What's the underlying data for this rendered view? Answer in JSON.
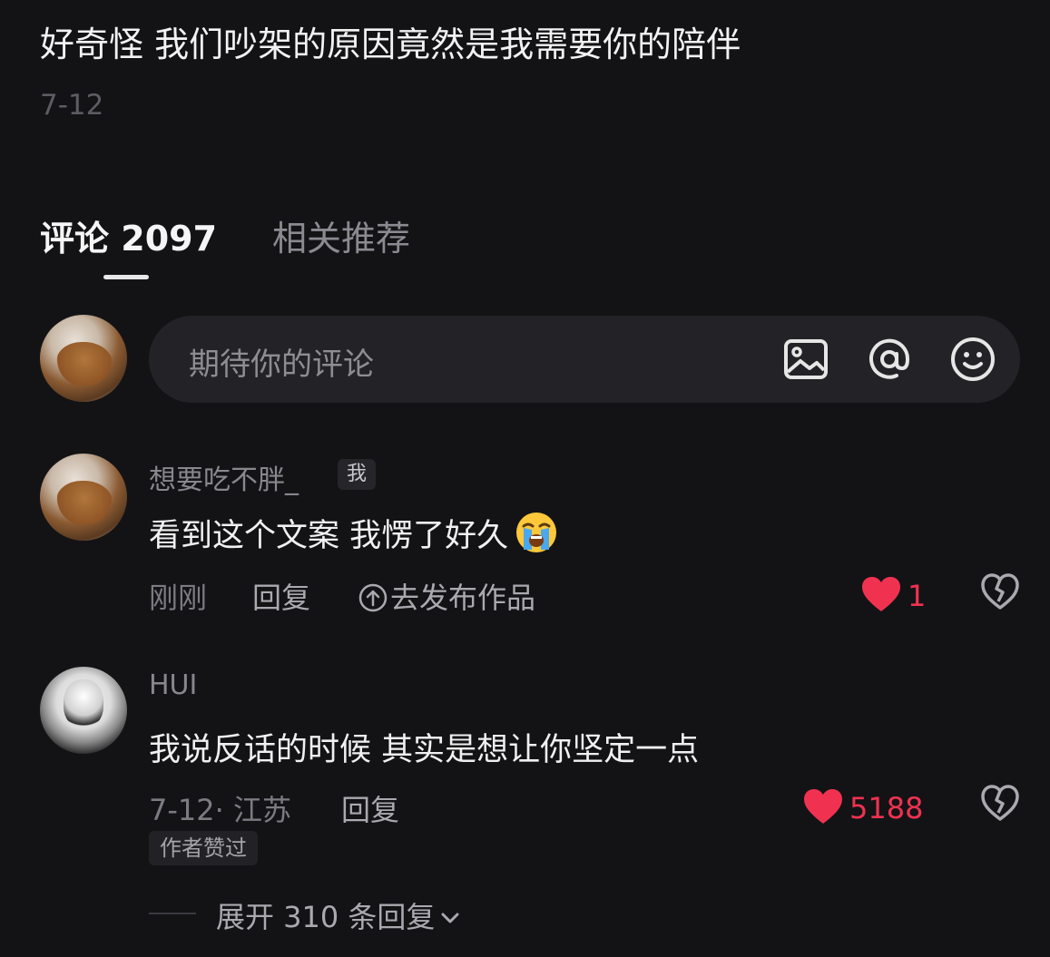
{
  "video": {
    "title": "好奇怪 我们吵架的原因竟然是我需要你的陪伴",
    "date": "7-12"
  },
  "tabs": {
    "comments_label": "评论",
    "comments_count": "2097",
    "related_label": "相关推荐"
  },
  "comment_input": {
    "placeholder": "期待你的评论"
  },
  "comments": [
    {
      "username": "想要吃不胖_",
      "self_badge": "我",
      "text": "看到这个文案 我愣了好久",
      "emoji": "loudly-crying-face",
      "time": "刚刚",
      "reply_label": "回复",
      "publish_label": "去发布作品",
      "likes": "1",
      "liked": true
    },
    {
      "username": "HUI",
      "text": "我说反话的时候 其实是想让你坚定一点",
      "time_location": "7-12· 江苏",
      "reply_label": "回复",
      "likes": "5188",
      "liked": true,
      "author_liked_label": "作者赞过",
      "expand_label": "展开 310 条回复"
    }
  ],
  "colors": {
    "background": "#131316",
    "like_red": "#f03250",
    "muted_text": "#87878d"
  }
}
